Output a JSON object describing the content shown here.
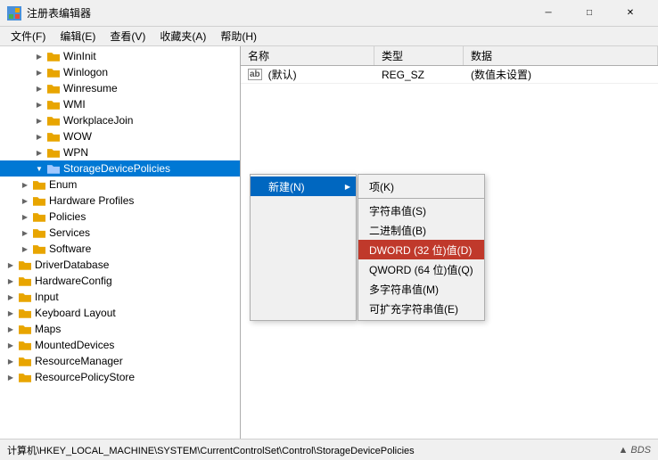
{
  "window": {
    "title": "注册表编辑器",
    "icon": "reg",
    "min_btn": "─",
    "max_btn": "□",
    "close_btn": "✕"
  },
  "menu": {
    "items": [
      "文件(F)",
      "编辑(E)",
      "查看(V)",
      "收藏夹(A)",
      "帮助(H)"
    ]
  },
  "tree": {
    "items": [
      {
        "label": "WinInit",
        "indent": 2,
        "expanded": false,
        "selected": false
      },
      {
        "label": "Winlogon",
        "indent": 2,
        "expanded": false,
        "selected": false
      },
      {
        "label": "Winresume",
        "indent": 2,
        "expanded": false,
        "selected": false
      },
      {
        "label": "WMI",
        "indent": 2,
        "expanded": false,
        "selected": false
      },
      {
        "label": "WorkplaceJoin",
        "indent": 2,
        "expanded": false,
        "selected": false
      },
      {
        "label": "WOW",
        "indent": 2,
        "expanded": false,
        "selected": false
      },
      {
        "label": "WPN",
        "indent": 2,
        "expanded": false,
        "selected": false
      },
      {
        "label": "StorageDevicePolicies",
        "indent": 2,
        "expanded": true,
        "selected": true
      },
      {
        "label": "Enum",
        "indent": 1,
        "expanded": false,
        "selected": false
      },
      {
        "label": "Hardware Profiles",
        "indent": 1,
        "expanded": false,
        "selected": false
      },
      {
        "label": "Policies",
        "indent": 1,
        "expanded": false,
        "selected": false
      },
      {
        "label": "Services",
        "indent": 1,
        "expanded": false,
        "selected": false
      },
      {
        "label": "Software",
        "indent": 1,
        "expanded": false,
        "selected": false
      },
      {
        "label": "DriverDatabase",
        "indent": 0,
        "expanded": false,
        "selected": false
      },
      {
        "label": "HardwareConfig",
        "indent": 0,
        "expanded": false,
        "selected": false
      },
      {
        "label": "Input",
        "indent": 0,
        "expanded": false,
        "selected": false
      },
      {
        "label": "Keyboard Layout",
        "indent": 0,
        "expanded": false,
        "selected": false
      },
      {
        "label": "Maps",
        "indent": 0,
        "expanded": false,
        "selected": false
      },
      {
        "label": "MountedDevices",
        "indent": 0,
        "expanded": false,
        "selected": false
      },
      {
        "label": "ResourceManager",
        "indent": 0,
        "expanded": false,
        "selected": false
      },
      {
        "label": "ResourcePolicyStore",
        "indent": 0,
        "expanded": false,
        "selected": false
      }
    ]
  },
  "table": {
    "columns": [
      "名称",
      "类型",
      "数据"
    ],
    "rows": [
      {
        "name": "(默认)",
        "type": "REG_SZ",
        "data": "(数值未设置)",
        "icon": "ab"
      }
    ]
  },
  "context_menu": {
    "trigger_label": "新建(N)",
    "trigger_arrow": "▶",
    "sub_items": [
      {
        "label": "项(K)",
        "highlighted": false
      },
      {
        "label": "字符串值(S)",
        "highlighted": false
      },
      {
        "label": "二进制值(B)",
        "highlighted": false
      },
      {
        "label": "DWORD (32 位)值(D)",
        "highlighted": true
      },
      {
        "label": "QWORD (64 位)值(Q)",
        "highlighted": false
      },
      {
        "label": "多字符串值(M)",
        "highlighted": false
      },
      {
        "label": "可扩充字符串值(E)",
        "highlighted": false
      }
    ]
  },
  "status_bar": {
    "path": "计算机\\HKEY_LOCAL_MACHINE\\SYSTEM\\CurrentControlSet\\Control\\StorageDevicePolicies",
    "logo": "▲ BDS"
  }
}
